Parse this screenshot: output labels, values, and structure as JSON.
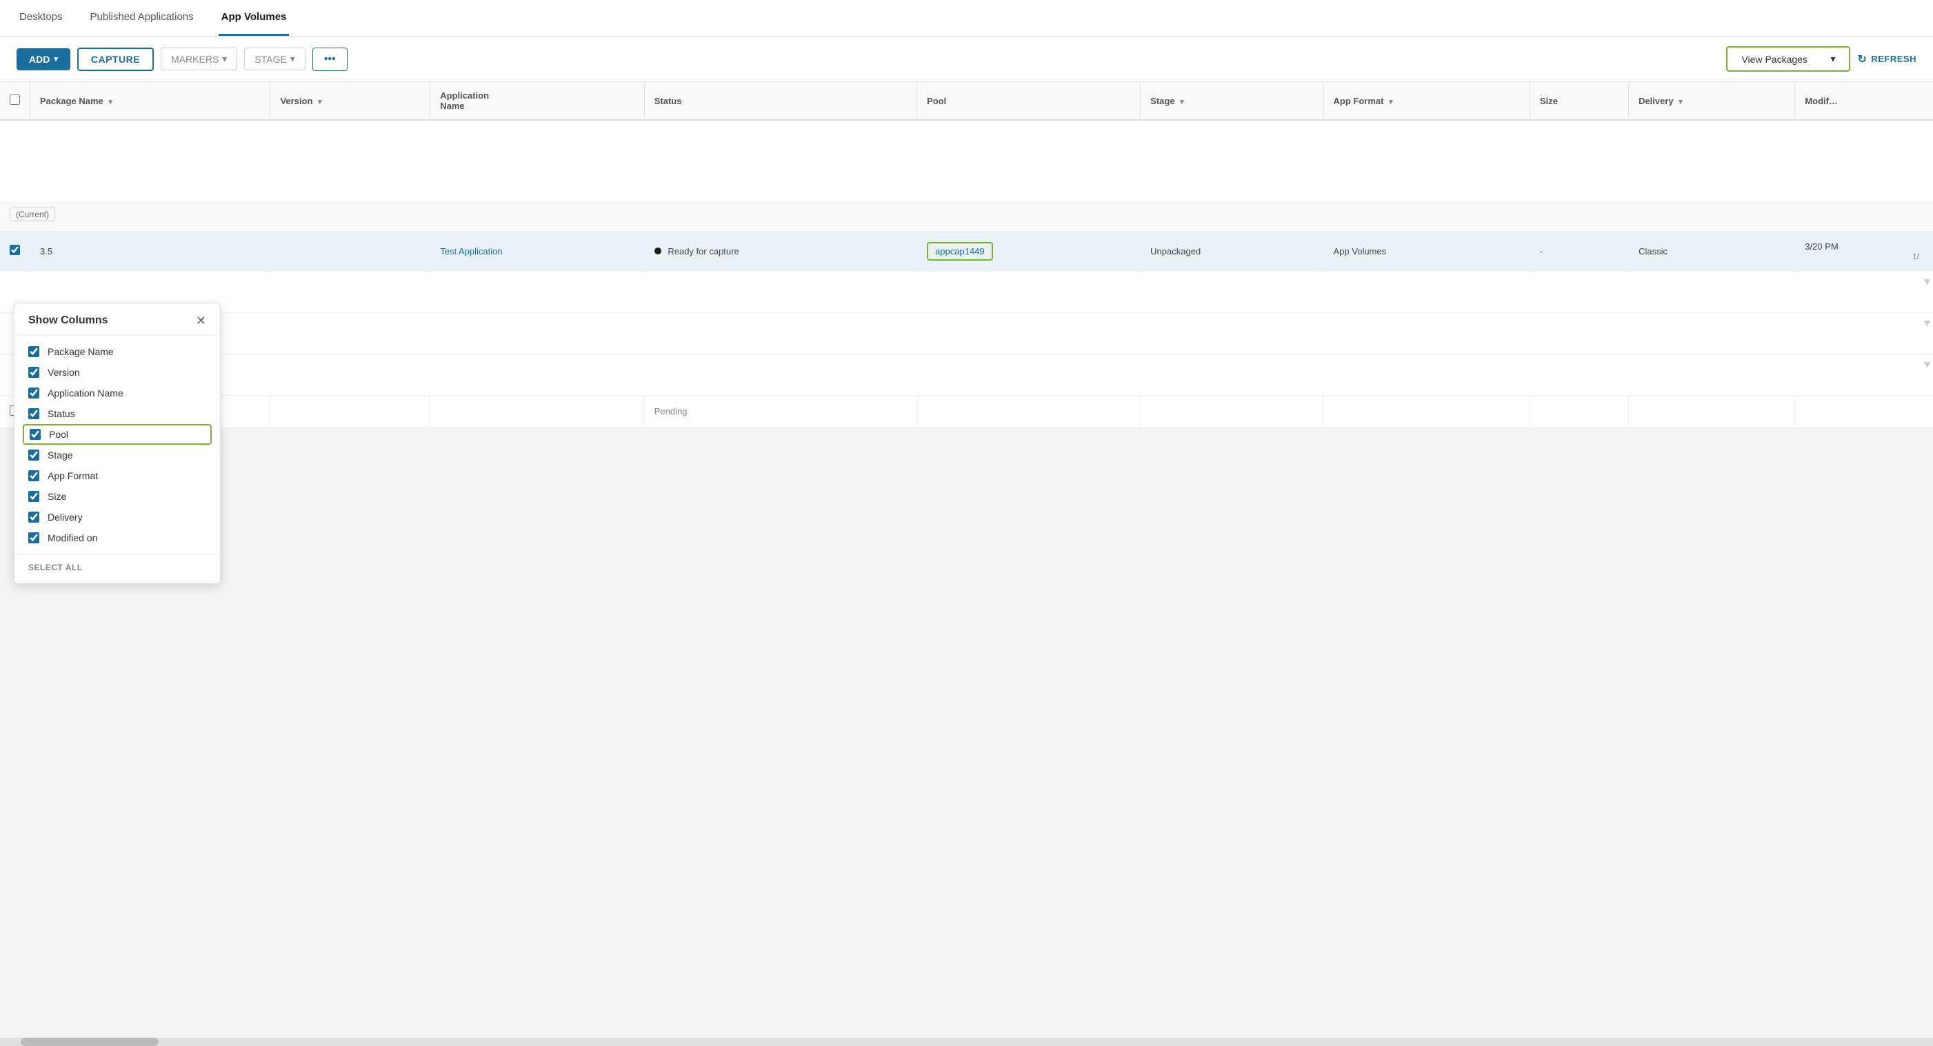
{
  "nav": {
    "tabs": [
      {
        "id": "desktops",
        "label": "Desktops",
        "active": false
      },
      {
        "id": "published-applications",
        "label": "Published Applications",
        "active": false
      },
      {
        "id": "app-volumes",
        "label": "App Volumes",
        "active": true
      }
    ]
  },
  "toolbar": {
    "add_label": "ADD",
    "capture_label": "CAPTURE",
    "markers_label": "MARKERS",
    "stage_label": "STAGE",
    "dots_label": "•••",
    "view_packages_label": "View Packages",
    "refresh_label": "REFRESH"
  },
  "table": {
    "columns": [
      {
        "id": "package-name",
        "label": "Package Name",
        "sortable": true
      },
      {
        "id": "version",
        "label": "Version",
        "sortable": true
      },
      {
        "id": "application-name",
        "label": "Application Name",
        "sortable": false
      },
      {
        "id": "status",
        "label": "Status",
        "sortable": false
      },
      {
        "id": "pool",
        "label": "Pool",
        "sortable": false
      },
      {
        "id": "stage",
        "label": "Stage",
        "sortable": true
      },
      {
        "id": "app-format",
        "label": "App Format",
        "sortable": true
      },
      {
        "id": "size",
        "label": "Size",
        "sortable": false
      },
      {
        "id": "delivery",
        "label": "Delivery",
        "sortable": true
      },
      {
        "id": "modified",
        "label": "Modif…",
        "sortable": false
      }
    ],
    "rows": [
      {
        "id": "row1",
        "package_name": "",
        "version": "3.5",
        "application_name": "Test Application",
        "status": "Ready for capture",
        "pool": "appcap1449",
        "stage": "Unpackaged",
        "app_format": "App Volumes",
        "size": "-",
        "delivery": "Classic",
        "modified": "3/20 PM",
        "selected": true,
        "page_num": "1/"
      },
      {
        "id": "row2",
        "package_name": "",
        "version": "",
        "application_name": "",
        "status": "Pending",
        "pool": "",
        "stage": "",
        "app_format": "",
        "size": "",
        "delivery": "",
        "modified": "",
        "selected": false,
        "page_num": ""
      }
    ],
    "current_marker": "Current"
  },
  "show_columns_panel": {
    "title": "Show Columns",
    "items": [
      {
        "id": "package-name",
        "label": "Package Name",
        "checked": true,
        "highlighted": false
      },
      {
        "id": "version",
        "label": "Version",
        "checked": true,
        "highlighted": false
      },
      {
        "id": "application-name",
        "label": "Application Name",
        "checked": true,
        "highlighted": false
      },
      {
        "id": "status",
        "label": "Status",
        "checked": true,
        "highlighted": false
      },
      {
        "id": "pool",
        "label": "Pool",
        "checked": true,
        "highlighted": true
      },
      {
        "id": "stage",
        "label": "Stage",
        "checked": true,
        "highlighted": false
      },
      {
        "id": "app-format",
        "label": "App Format",
        "checked": true,
        "highlighted": false
      },
      {
        "id": "size",
        "label": "Size",
        "checked": true,
        "highlighted": false
      },
      {
        "id": "delivery",
        "label": "Delivery",
        "checked": true,
        "highlighted": false
      },
      {
        "id": "modified-on",
        "label": "Modified on",
        "checked": true,
        "highlighted": false
      }
    ],
    "select_all_label": "SELECT ALL"
  },
  "colors": {
    "primary": "#1a6e9e",
    "accent_green": "#7ab32e",
    "capture_border": "#1a6e9e"
  }
}
